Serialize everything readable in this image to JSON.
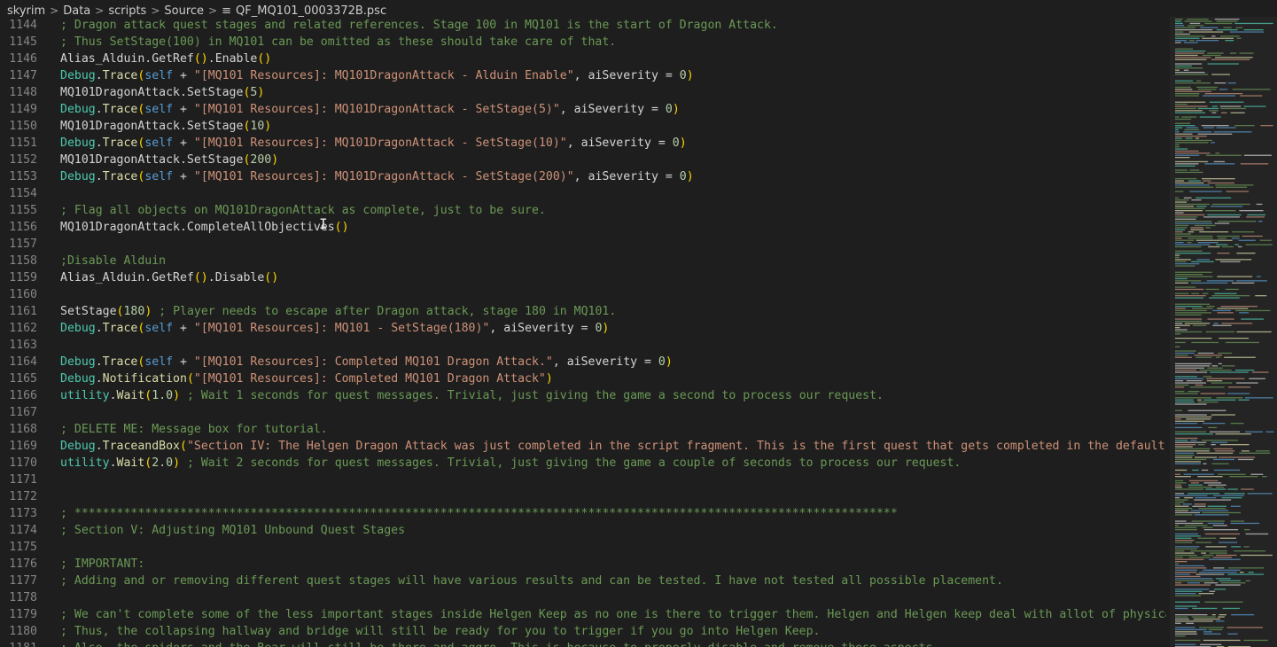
{
  "breadcrumb": {
    "items": [
      "skyrim",
      "Data",
      "scripts",
      "Source"
    ],
    "separator": ">",
    "file_icon": "≡",
    "file": "QF_MQ101_0003372B.psc"
  },
  "colors": {
    "background": "#1e1e1e",
    "comment": "#6a9955",
    "string": "#ce9178",
    "keyword": "#569cd6",
    "type": "#4ec9b0",
    "function": "#dcdcaa",
    "number": "#b5cea8",
    "paren": "#ffd700",
    "line_number": "#858585"
  },
  "editor": {
    "lines": [
      {
        "n": "1144",
        "tokens": [
          [
            "comment",
            "; Dragon attack quest stages and related references. Stage 100 in MQ101 is the start of Dragon Attack."
          ]
        ]
      },
      {
        "n": "1145",
        "tokens": [
          [
            "comment",
            "; Thus SetStage(100) in MQ101 can be omitted as these should take care of that."
          ]
        ]
      },
      {
        "n": "1146",
        "tokens": [
          [
            "ident",
            "Alias_Alduin.GetRef"
          ],
          [
            "paren",
            "()"
          ],
          [
            "ident",
            ".Enable"
          ],
          [
            "paren",
            "()"
          ]
        ]
      },
      {
        "n": "1147",
        "tokens": [
          [
            "type",
            "Debug"
          ],
          [
            "ident",
            "."
          ],
          [
            "func",
            "Trace"
          ],
          [
            "paren",
            "("
          ],
          [
            "self",
            "self"
          ],
          [
            "ident",
            " + "
          ],
          [
            "string",
            "\"[MQ101 Resources]: MQ101DragonAttack - Alduin Enable\""
          ],
          [
            "ident",
            ", aiSeverity = "
          ],
          [
            "number",
            "0"
          ],
          [
            "paren",
            ")"
          ]
        ]
      },
      {
        "n": "1148",
        "tokens": [
          [
            "ident",
            "MQ101DragonAttack.SetStage"
          ],
          [
            "paren",
            "("
          ],
          [
            "number",
            "5"
          ],
          [
            "paren",
            ")"
          ]
        ]
      },
      {
        "n": "1149",
        "tokens": [
          [
            "type",
            "Debug"
          ],
          [
            "ident",
            "."
          ],
          [
            "func",
            "Trace"
          ],
          [
            "paren",
            "("
          ],
          [
            "self",
            "self"
          ],
          [
            "ident",
            " + "
          ],
          [
            "string",
            "\"[MQ101 Resources]: MQ101DragonAttack - SetStage(5)\""
          ],
          [
            "ident",
            ", aiSeverity = "
          ],
          [
            "number",
            "0"
          ],
          [
            "paren",
            ")"
          ]
        ]
      },
      {
        "n": "1150",
        "tokens": [
          [
            "ident",
            "MQ101DragonAttack.SetStage"
          ],
          [
            "paren",
            "("
          ],
          [
            "number",
            "10"
          ],
          [
            "paren",
            ")"
          ]
        ]
      },
      {
        "n": "1151",
        "tokens": [
          [
            "type",
            "Debug"
          ],
          [
            "ident",
            "."
          ],
          [
            "func",
            "Trace"
          ],
          [
            "paren",
            "("
          ],
          [
            "self",
            "self"
          ],
          [
            "ident",
            " + "
          ],
          [
            "string",
            "\"[MQ101 Resources]: MQ101DragonAttack - SetStage(10)\""
          ],
          [
            "ident",
            ", aiSeverity = "
          ],
          [
            "number",
            "0"
          ],
          [
            "paren",
            ")"
          ]
        ]
      },
      {
        "n": "1152",
        "tokens": [
          [
            "ident",
            "MQ101DragonAttack.SetStage"
          ],
          [
            "paren",
            "("
          ],
          [
            "number",
            "200"
          ],
          [
            "paren",
            ")"
          ]
        ]
      },
      {
        "n": "1153",
        "tokens": [
          [
            "type",
            "Debug"
          ],
          [
            "ident",
            "."
          ],
          [
            "func",
            "Trace"
          ],
          [
            "paren",
            "("
          ],
          [
            "self",
            "self"
          ],
          [
            "ident",
            " + "
          ],
          [
            "string",
            "\"[MQ101 Resources]: MQ101DragonAttack - SetStage(200)\""
          ],
          [
            "ident",
            ", aiSeverity = "
          ],
          [
            "number",
            "0"
          ],
          [
            "paren",
            ")"
          ]
        ]
      },
      {
        "n": "1154",
        "tokens": []
      },
      {
        "n": "1155",
        "tokens": [
          [
            "comment",
            "; Flag all objects on MQ101DragonAttack as complete, just to be sure."
          ]
        ]
      },
      {
        "n": "1156",
        "tokens": [
          [
            "ident",
            "MQ101DragonAttack.CompleteAllObjectives"
          ],
          [
            "paren",
            "()"
          ]
        ]
      },
      {
        "n": "1157",
        "tokens": []
      },
      {
        "n": "1158",
        "tokens": [
          [
            "comment",
            ";Disable Alduin"
          ]
        ]
      },
      {
        "n": "1159",
        "tokens": [
          [
            "ident",
            "Alias_Alduin.GetRef"
          ],
          [
            "paren",
            "()"
          ],
          [
            "ident",
            ".Disable"
          ],
          [
            "paren",
            "()"
          ]
        ]
      },
      {
        "n": "1160",
        "tokens": []
      },
      {
        "n": "1161",
        "tokens": [
          [
            "ident",
            "SetStage"
          ],
          [
            "paren",
            "("
          ],
          [
            "number",
            "180"
          ],
          [
            "paren",
            ")"
          ],
          [
            "ident",
            " "
          ],
          [
            "comment",
            "; Player needs to escape after Dragon attack, stage 180 in MQ101."
          ]
        ]
      },
      {
        "n": "1162",
        "tokens": [
          [
            "type",
            "Debug"
          ],
          [
            "ident",
            "."
          ],
          [
            "func",
            "Trace"
          ],
          [
            "paren",
            "("
          ],
          [
            "self",
            "self"
          ],
          [
            "ident",
            " + "
          ],
          [
            "string",
            "\"[MQ101 Resources]: MQ101 - SetStage(180)\""
          ],
          [
            "ident",
            ", aiSeverity = "
          ],
          [
            "number",
            "0"
          ],
          [
            "paren",
            ")"
          ]
        ]
      },
      {
        "n": "1163",
        "tokens": []
      },
      {
        "n": "1164",
        "tokens": [
          [
            "type",
            "Debug"
          ],
          [
            "ident",
            "."
          ],
          [
            "func",
            "Trace"
          ],
          [
            "paren",
            "("
          ],
          [
            "self",
            "self"
          ],
          [
            "ident",
            " + "
          ],
          [
            "string",
            "\"[MQ101 Resources]: Completed MQ101 Dragon Attack.\""
          ],
          [
            "ident",
            ", aiSeverity = "
          ],
          [
            "number",
            "0"
          ],
          [
            "paren",
            ")"
          ]
        ]
      },
      {
        "n": "1165",
        "tokens": [
          [
            "type",
            "Debug"
          ],
          [
            "ident",
            "."
          ],
          [
            "func",
            "Notification"
          ],
          [
            "paren",
            "("
          ],
          [
            "string",
            "\"[MQ101 Resources]: Completed MQ101 Dragon Attack\""
          ],
          [
            "paren",
            ")"
          ]
        ]
      },
      {
        "n": "1166",
        "tokens": [
          [
            "type",
            "utility"
          ],
          [
            "ident",
            "."
          ],
          [
            "func",
            "Wait"
          ],
          [
            "paren",
            "("
          ],
          [
            "number",
            "1.0"
          ],
          [
            "paren",
            ")"
          ],
          [
            "ident",
            " "
          ],
          [
            "comment",
            "; Wait 1 seconds for quest messages. Trivial, just giving the game a second to process our request."
          ]
        ]
      },
      {
        "n": "1167",
        "tokens": []
      },
      {
        "n": "1168",
        "tokens": [
          [
            "comment",
            "; DELETE ME: Message box for tutorial."
          ]
        ]
      },
      {
        "n": "1169",
        "tokens": [
          [
            "type",
            "Debug"
          ],
          [
            "ident",
            "."
          ],
          [
            "func",
            "TraceandBox"
          ],
          [
            "paren",
            "("
          ],
          [
            "string",
            "\"Section IV: The Helgen Dragon Attack was just completed in the script fragment. This is the first quest that gets completed in the default game"
          ]
        ]
      },
      {
        "n": "1170",
        "tokens": [
          [
            "type",
            "utility"
          ],
          [
            "ident",
            "."
          ],
          [
            "func",
            "Wait"
          ],
          [
            "paren",
            "("
          ],
          [
            "number",
            "2.0"
          ],
          [
            "paren",
            ")"
          ],
          [
            "ident",
            " "
          ],
          [
            "comment",
            "; Wait 2 seconds for quest messages. Trivial, just giving the game a couple of seconds to process our request."
          ]
        ]
      },
      {
        "n": "1171",
        "tokens": []
      },
      {
        "n": "1172",
        "tokens": []
      },
      {
        "n": "1173",
        "tokens": [
          [
            "comment",
            "; *********************************************************************************************************************"
          ]
        ]
      },
      {
        "n": "1174",
        "tokens": [
          [
            "comment",
            "; Section V: Adjusting MQ101 Unbound Quest Stages"
          ]
        ]
      },
      {
        "n": "1175",
        "tokens": []
      },
      {
        "n": "1176",
        "tokens": [
          [
            "comment",
            "; IMPORTANT:"
          ]
        ]
      },
      {
        "n": "1177",
        "tokens": [
          [
            "comment",
            "; Adding and or removing different quest stages will have various results and can be tested. I have not tested all possible placement."
          ]
        ]
      },
      {
        "n": "1178",
        "tokens": []
      },
      {
        "n": "1179",
        "tokens": [
          [
            "comment",
            "; We can't complete some of the less important stages inside Helgen Keep as no one is there to trigger them. Helgen and Helgen keep deal with allot of physical in"
          ]
        ]
      },
      {
        "n": "1180",
        "tokens": [
          [
            "comment",
            "; Thus, the collapsing hallway and bridge will still be ready for you to trigger if you go into Helgen Keep."
          ]
        ]
      },
      {
        "n": "1181",
        "tokens": [
          [
            "comment",
            "; Also, the spiders and the Bear will still be there and aggro. This is because to properly disable and remove those aspects"
          ]
        ]
      }
    ]
  }
}
